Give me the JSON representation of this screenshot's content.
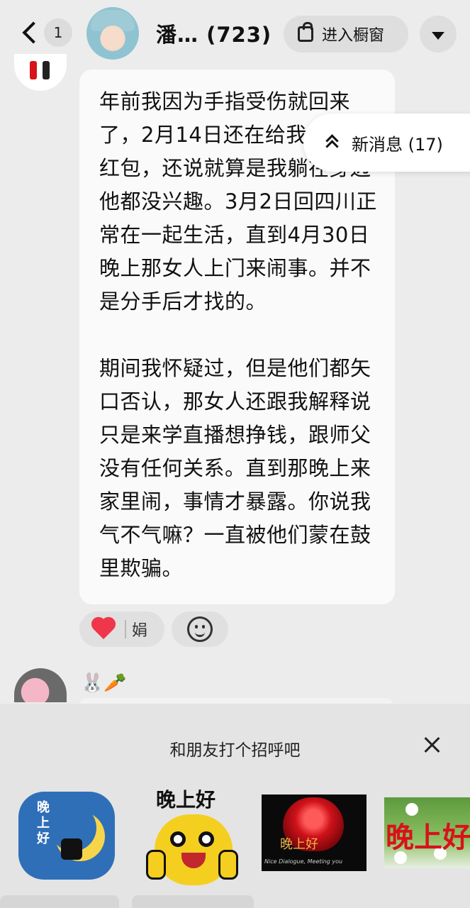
{
  "header": {
    "unread_count": "1",
    "chat_name": "潘…",
    "member_count": "(723)",
    "shop_button_label": "进入橱窗"
  },
  "message": {
    "text": "年前我因为手指受伤就回来了，2月14日还在给我发520红包，还说就算是我躺在身边他都没兴趣。3月2日回四川正常在一起生活，直到4月30日晚上那女人上门来闹事。并不是分手后才找的。\n\n期间我怀疑过，但是他们都矢口否认，那女人还跟我解释说只是来学直播想挣钱，跟师父没有任何关系。直到那晚上来家里闹，事情才暴露。你说我气不气嘛？一直被他们蒙在鼓里欺骗。"
  },
  "new_messages": {
    "label": "新消息 (17)"
  },
  "reaction": {
    "name": "娟"
  },
  "next_message": {
    "emoji": "🐰🥕"
  },
  "greeting_panel": {
    "title": "和朋友打个招呼吧",
    "stickers": [
      {
        "text": "晚上好",
        "icon": "moon-sticker"
      },
      {
        "text": "晚上好",
        "icon": "emoji-face-sticker"
      },
      {
        "text": "晚上好",
        "script": "Nice Dialogue, Meeting you",
        "icon": "rose-sticker"
      },
      {
        "text": "晚上好",
        "icon": "flower-sticker"
      }
    ]
  },
  "colors": {
    "background": "#ececec",
    "bubble": "#fafafa",
    "heart": "#f0364a",
    "panel": "#e4e4e4"
  }
}
